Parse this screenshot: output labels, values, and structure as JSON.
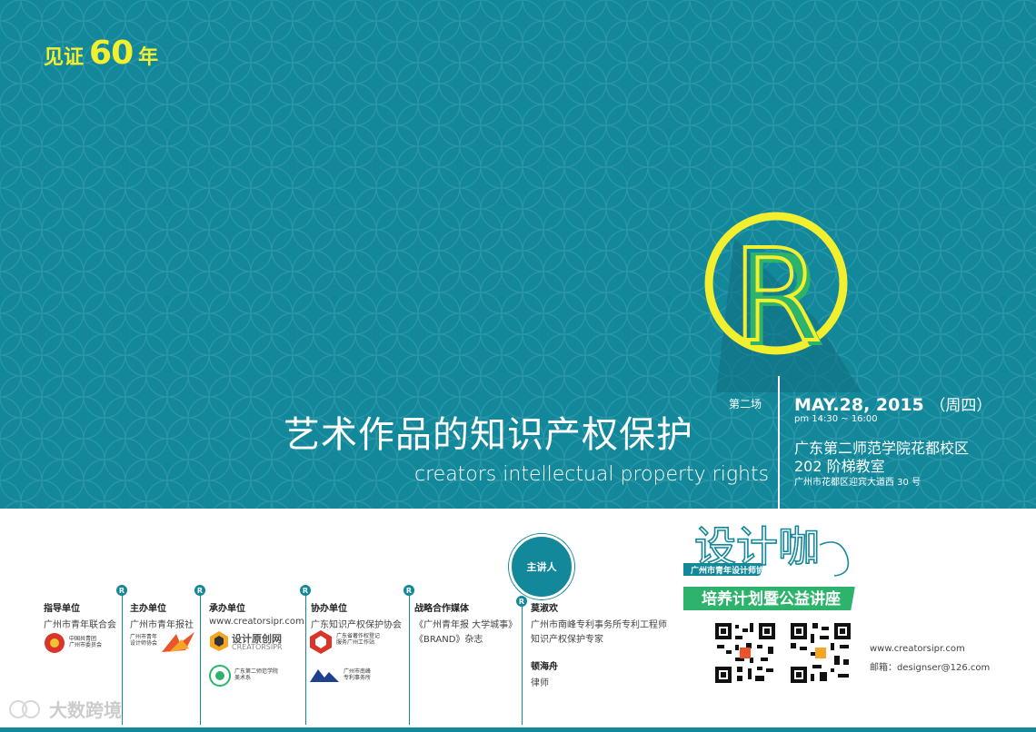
{
  "badge": {
    "prefix": "见证",
    "number": "60",
    "suffix": "年"
  },
  "logo": {
    "letter": "R"
  },
  "session": "第二场",
  "title_cn": "艺术作品的知识产权保护",
  "title_en": "creators intellectual property rights",
  "event": {
    "date": "MAY.28, 2015",
    "dow": "（周四）",
    "time": "pm 14:30 ~ 16:00",
    "venue1": "广东第二师范学院花都校区",
    "venue2": "202 阶梯教室",
    "venue3": "广州市花都区迎宾大道西 30 号"
  },
  "brand": {
    "word": "设计咖",
    "assoc": "广州市青年设计师协会",
    "slogan": "培养计划暨公益讲座"
  },
  "host_badge": "主讲人",
  "sponsors": [
    {
      "label": "指导单位",
      "text": "广州市青年联合会",
      "logo_text": "中国共青团\n广州市委员会"
    },
    {
      "label": "主办单位",
      "text": "广州市青年报社",
      "logo_text": "广州市青年\n设计师协会"
    },
    {
      "label": "承办单位",
      "text": "www.creatorsipr.com",
      "logo_text": "设计原创网",
      "logo_sub": "CREATORSIPR",
      "logo2_text": "广东第二师范学院\n美术系"
    },
    {
      "label": "协办单位",
      "text": "广东知识产权保护协会",
      "logo_text": "广东省著作权登记\n服务广州工作站",
      "logo2_text": "广州市南峰\n专利事务所"
    },
    {
      "label": "战略合作媒体",
      "text": "《广州青年报 大学城事》",
      "text2": "《BRAND》杂志"
    }
  ],
  "speakers": {
    "name1": "莫淑欢",
    "desc1a": "广州市南峰专利事务所专利工程师",
    "desc1b": "知识产权保护专家",
    "name2": "顿海舟",
    "desc2": "律师"
  },
  "contact": {
    "web": "www.creatorsipr.com",
    "mail": "邮箱：designser@126.com"
  },
  "watermark": "大数跨境",
  "colors": {
    "teal": "#14889b",
    "yellow": "#f2ef2e",
    "green": "#2db36b"
  }
}
